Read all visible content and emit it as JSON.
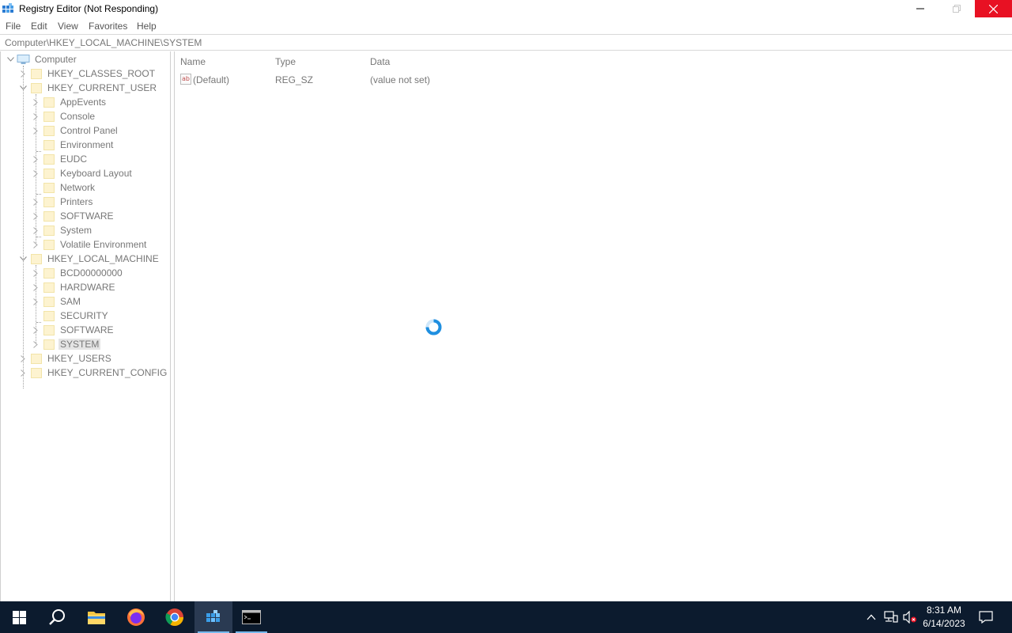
{
  "window": {
    "title": "Registry Editor (Not Responding)"
  },
  "menu": [
    "File",
    "Edit",
    "View",
    "Favorites",
    "Help"
  ],
  "address": "Computer\\HKEY_LOCAL_MACHINE\\SYSTEM",
  "tree": {
    "root": "Computer",
    "hkcr": "HKEY_CLASSES_ROOT",
    "hkcu": "HKEY_CURRENT_USER",
    "hkcu_children": [
      "AppEvents",
      "Console",
      "Control Panel",
      "Environment",
      "EUDC",
      "Keyboard Layout",
      "Network",
      "Printers",
      "SOFTWARE",
      "System",
      "Volatile Environment"
    ],
    "hklm": "HKEY_LOCAL_MACHINE",
    "hklm_children": [
      "BCD00000000",
      "HARDWARE",
      "SAM",
      "SECURITY",
      "SOFTWARE",
      "SYSTEM"
    ],
    "hku": "HKEY_USERS",
    "hkcc": "HKEY_CURRENT_CONFIG",
    "selected": "SYSTEM"
  },
  "list": {
    "columns": [
      "Name",
      "Type",
      "Data"
    ],
    "rows": [
      {
        "name": "(Default)",
        "type": "REG_SZ",
        "data": "(value not set)",
        "icon": "string-value-icon"
      }
    ]
  },
  "taskbar": {
    "time": "8:31 AM",
    "date": "6/14/2023",
    "apps": [
      "start-icon",
      "search-icon",
      "file-explorer-icon",
      "firefox-icon",
      "chrome-icon",
      "registry-editor-icon",
      "command-prompt-icon"
    ]
  },
  "colors": {
    "taskbar": "#0c1b2e",
    "close_button": "#e81123",
    "selection": "#e4e4e4",
    "busy_cursor": "#1f8fe0"
  }
}
